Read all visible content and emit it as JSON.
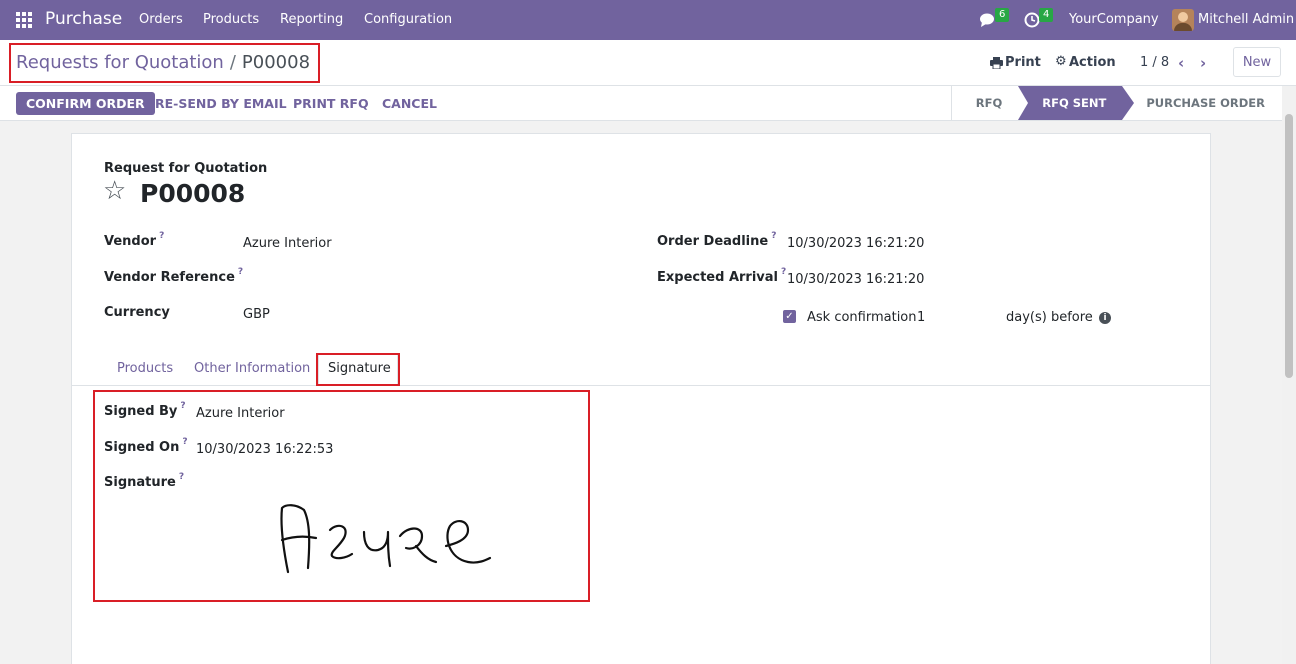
{
  "navbar": {
    "app_name": "Purchase",
    "menu": [
      "Orders",
      "Products",
      "Reporting",
      "Configuration"
    ],
    "messages_count": "6",
    "activities_count": "4",
    "company": "YourCompany",
    "user": "Mitchell Admin"
  },
  "control_panel": {
    "breadcrumb_parent": "Requests for Quotation",
    "breadcrumb_separator": "/",
    "breadcrumb_current": "P00008",
    "print_label": "Print",
    "action_label": "Action",
    "pager": "1 / 8",
    "new_label": "New"
  },
  "statusbar": {
    "buttons": [
      "CONFIRM ORDER",
      "RE-SEND BY EMAIL",
      "PRINT RFQ",
      "CANCEL"
    ],
    "stages": [
      "RFQ",
      "RFQ SENT",
      "PURCHASE ORDER"
    ],
    "active_stage": "RFQ SENT"
  },
  "form": {
    "subtitle": "Request for Quotation",
    "title": "P00008",
    "left_fields": [
      {
        "label": "Vendor",
        "value": "Azure Interior",
        "tooltip": "?"
      },
      {
        "label": "Vendor Reference",
        "value": "",
        "tooltip": "?"
      },
      {
        "label": "Currency",
        "value": "GBP",
        "tooltip": ""
      }
    ],
    "right_fields": [
      {
        "label": "Order Deadline",
        "value": "10/30/2023 16:21:20",
        "tooltip": "?"
      },
      {
        "label": "Expected Arrival",
        "value": "10/30/2023 16:21:20",
        "tooltip": "?"
      }
    ],
    "ask_confirmation": {
      "label": "Ask confirmation",
      "days": "1",
      "suffix": "day(s) before",
      "checked": true
    },
    "tabs": [
      "Products",
      "Other Information",
      "Signature"
    ],
    "active_tab": "Signature",
    "signature_tab": {
      "signed_by_label": "Signed By",
      "signed_by": "Azure Interior",
      "signed_on_label": "Signed On",
      "signed_on": "10/30/2023 16:22:53",
      "signature_label": "Signature",
      "signature_text": "Azure"
    }
  },
  "colors": {
    "brand": "#71639e",
    "highlight_box": "#d91e26",
    "badge": "#28a745"
  }
}
